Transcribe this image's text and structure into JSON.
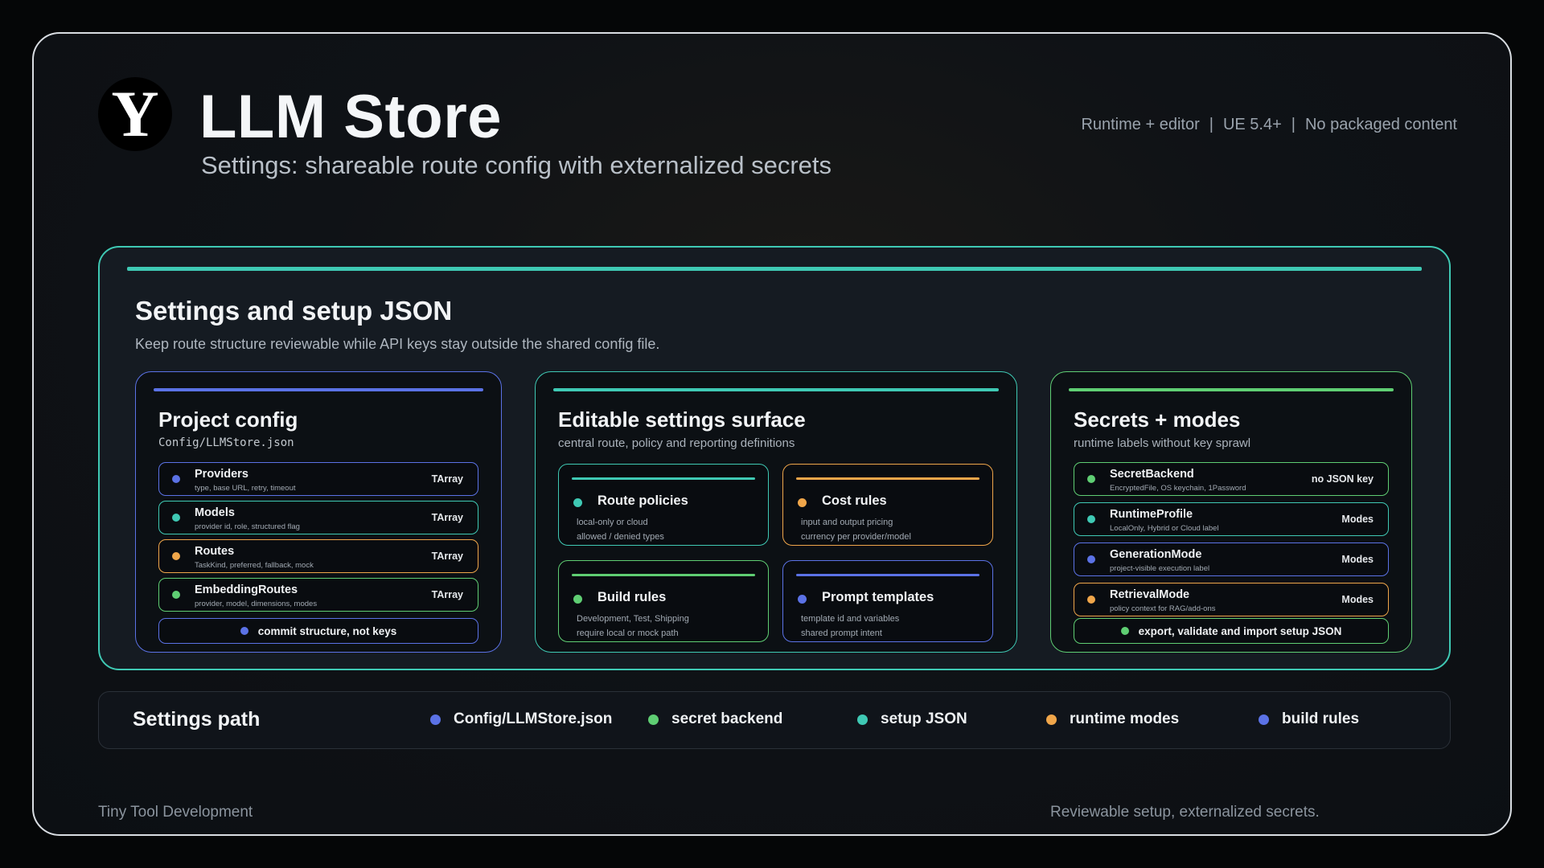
{
  "header": {
    "logo_letter": "Y",
    "title": "LLM Store",
    "subtitle": "Settings: shareable route config with externalized secrets",
    "meta": [
      "Runtime + editor",
      "UE 5.4+",
      "No packaged content"
    ],
    "meta_separator": "|"
  },
  "main": {
    "title": "Settings and setup JSON",
    "description": "Keep route structure reviewable while API keys stay outside the shared config file."
  },
  "project_config": {
    "title": "Project config",
    "path": "Config/LLMStore.json",
    "rows": [
      {
        "name": "Providers",
        "desc": "type, base URL, retry, timeout",
        "tag": "TArray",
        "color": "#5b72e6"
      },
      {
        "name": "Models",
        "desc": "provider id, role, structured flag",
        "tag": "TArray",
        "color": "#3fc9b4"
      },
      {
        "name": "Routes",
        "desc": "TaskKind, preferred, fallback, mock",
        "tag": "TArray",
        "color": "#f0a64a"
      },
      {
        "name": "EmbeddingRoutes",
        "desc": "provider, model, dimensions, modes",
        "tag": "TArray",
        "color": "#5fce73"
      }
    ],
    "footer": "commit structure, not keys"
  },
  "editable_settings": {
    "title": "Editable settings surface",
    "subtitle": "central route, policy and reporting definitions",
    "cards": [
      {
        "name": "Route policies",
        "line1": "local-only or cloud",
        "line2": "allowed / denied types",
        "color": "#3fc9b4"
      },
      {
        "name": "Cost rules",
        "line1": "input and output pricing",
        "line2": "currency per provider/model",
        "color": "#f0a64a"
      },
      {
        "name": "Build rules",
        "line1": "Development, Test, Shipping",
        "line2": "require local or mock path",
        "color": "#5fce73"
      },
      {
        "name": "Prompt templates",
        "line1": "template id and variables",
        "line2": "shared prompt intent",
        "color": "#5b72e6"
      }
    ]
  },
  "secrets_modes": {
    "title": "Secrets + modes",
    "subtitle": "runtime labels without key sprawl",
    "rows": [
      {
        "name": "SecretBackend",
        "desc": "EncryptedFile, OS keychain, 1Password",
        "tag": "no JSON key",
        "color": "#5fce73"
      },
      {
        "name": "RuntimeProfile",
        "desc": "LocalOnly, Hybrid or Cloud label",
        "tag": "Modes",
        "color": "#3fc9b4"
      },
      {
        "name": "GenerationMode",
        "desc": "project-visible execution label",
        "tag": "Modes",
        "color": "#5b72e6"
      },
      {
        "name": "RetrievalMode",
        "desc": "policy context for RAG/add-ons",
        "tag": "Modes",
        "color": "#f0a64a"
      }
    ],
    "footer": "export, validate and import setup JSON"
  },
  "settings_path": {
    "title": "Settings path",
    "items": [
      {
        "label": "Config/LLMStore.json",
        "color": "#5b72e6"
      },
      {
        "label": "secret backend",
        "color": "#5fce73"
      },
      {
        "label": "setup JSON",
        "color": "#3fc9b4"
      },
      {
        "label": "runtime modes",
        "color": "#f0a64a"
      },
      {
        "label": "build rules",
        "color": "#5b72e6"
      }
    ]
  },
  "footer": {
    "left": "Tiny Tool Development",
    "right": "Reviewable setup, externalized secrets."
  },
  "colors": {
    "blue": "#5b72e6",
    "teal": "#3fc9b4",
    "orange": "#f0a64a",
    "green": "#5fce73"
  }
}
